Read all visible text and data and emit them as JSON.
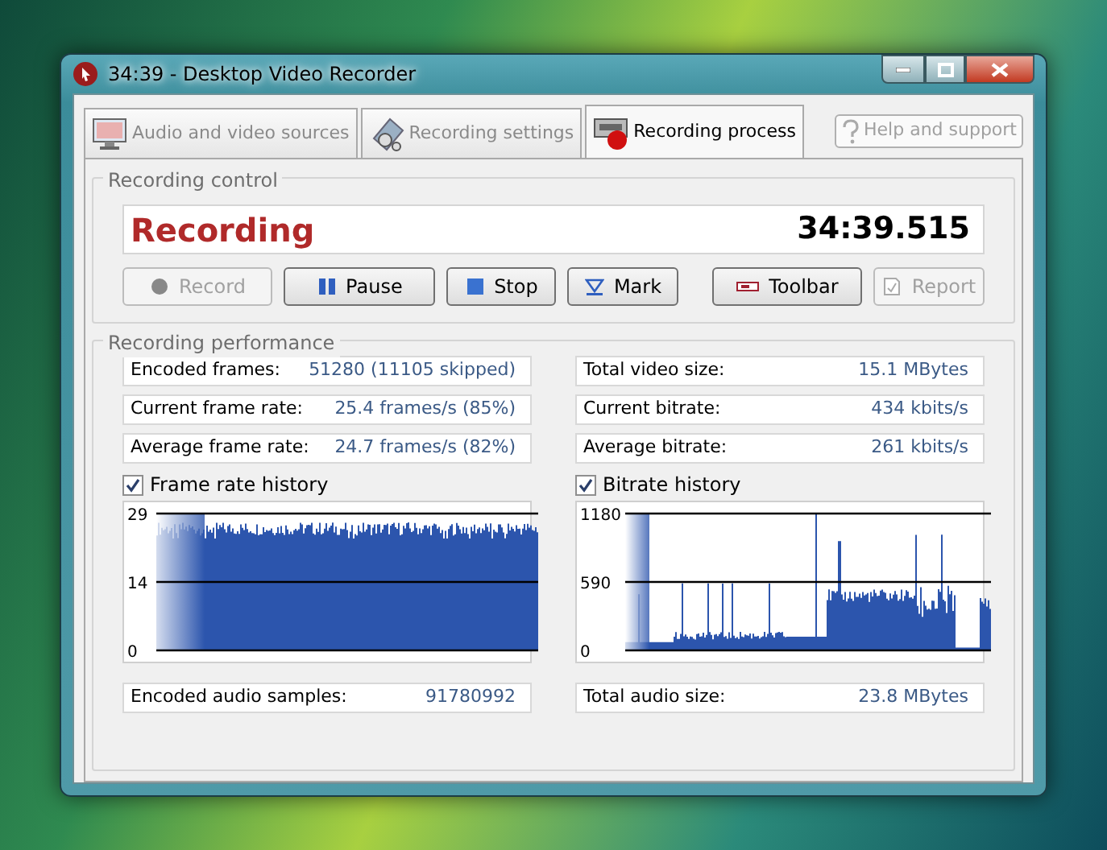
{
  "window": {
    "title": "34:39 - Desktop Video Recorder"
  },
  "tabs": [
    {
      "label": "Audio and video sources",
      "selected": false,
      "kind": "sources"
    },
    {
      "label": "Recording settings",
      "selected": false,
      "kind": "settings"
    },
    {
      "label": "Recording process",
      "selected": true,
      "kind": "process"
    }
  ],
  "help_button": {
    "label": "Help and support",
    "disabled": true
  },
  "recording_control": {
    "legend": "Recording control",
    "status": "Recording",
    "elapsed": "34:39.515",
    "buttons": [
      {
        "label": "Record",
        "kind": "record",
        "disabled": true
      },
      {
        "label": "Pause",
        "kind": "pause",
        "disabled": false
      },
      {
        "label": "Stop",
        "kind": "stop",
        "disabled": false
      },
      {
        "label": "Mark",
        "kind": "mark",
        "disabled": false
      },
      {
        "label": "Toolbar",
        "kind": "toolbar",
        "disabled": false
      },
      {
        "label": "Report",
        "kind": "report",
        "disabled": true
      }
    ]
  },
  "recording_performance": {
    "legend": "Recording performance",
    "left_stats": [
      {
        "label": "Encoded frames:",
        "value": "51280 (11105 skipped)"
      },
      {
        "label": "Current frame rate:",
        "value": "25.4 frames/s (85%)"
      },
      {
        "label": "Average frame rate:",
        "value": "24.7 frames/s (82%)"
      }
    ],
    "right_stats": [
      {
        "label": "Total video size:",
        "value": "15.1 MBytes"
      },
      {
        "label": "Current bitrate:",
        "value": "434 kbits/s"
      },
      {
        "label": "Average bitrate:",
        "value": "261 kbits/s"
      }
    ],
    "histories": [
      {
        "label": "Frame rate history",
        "checked": true,
        "kind": "framerate",
        "scale_labels": [
          "29",
          "14",
          "0"
        ]
      },
      {
        "label": "Bitrate history",
        "checked": true,
        "kind": "bitrate",
        "scale_labels": [
          "1180",
          "590",
          "0"
        ]
      }
    ],
    "audio_stats": [
      {
        "label": "Encoded audio samples:",
        "value": "91780992"
      },
      {
        "label": "Total audio size:",
        "value": "23.8 MBytes"
      }
    ]
  }
}
